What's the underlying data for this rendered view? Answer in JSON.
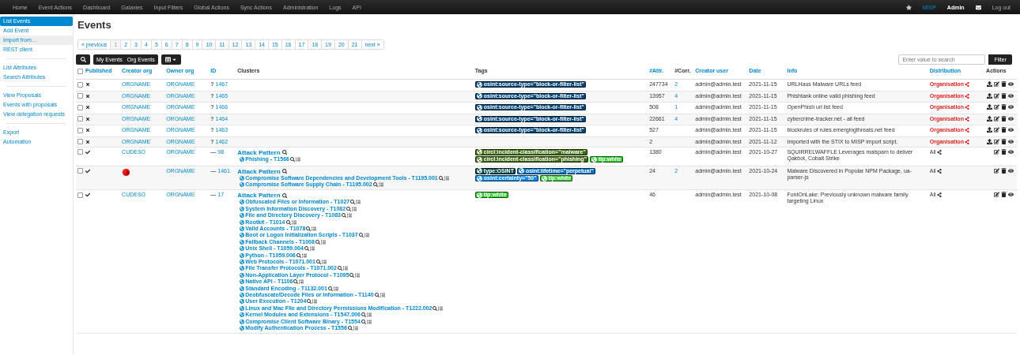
{
  "top_nav": {
    "items": [
      "Home",
      "Event Actions",
      "Dashboard",
      "Galaxies",
      "Input Filters",
      "Global Actions",
      "Sync Actions",
      "Administration",
      "Logs",
      "API"
    ],
    "instance": "MISP",
    "user": "Admin",
    "logout": "Log out"
  },
  "sidebar": {
    "groups": [
      [
        {
          "label": "List Events",
          "selected": true,
          "highlighted": false
        },
        {
          "label": "Add Event",
          "selected": false,
          "highlighted": false
        },
        {
          "label": "Import from…",
          "selected": false,
          "highlighted": true
        },
        {
          "label": "REST client",
          "selected": false,
          "highlighted": false
        }
      ],
      [
        {
          "label": "List Attributes",
          "selected": false,
          "highlighted": false
        },
        {
          "label": "Search Attributes",
          "selected": false,
          "highlighted": false
        }
      ],
      [
        {
          "label": "View Proposals",
          "selected": false,
          "highlighted": false
        },
        {
          "label": "Events with proposals",
          "selected": false,
          "highlighted": false
        },
        {
          "label": "View delegation requests",
          "selected": false,
          "highlighted": false
        }
      ],
      [
        {
          "label": "Export",
          "selected": false,
          "highlighted": false
        },
        {
          "label": "Automation",
          "selected": false,
          "highlighted": false
        }
      ]
    ]
  },
  "title": "Events",
  "pagination": {
    "previous": "« previous",
    "next": "next »",
    "pages": [
      {
        "label": "1",
        "selected": true
      },
      {
        "label": "2",
        "selected": false
      },
      {
        "label": "3",
        "selected": false
      },
      {
        "label": "4",
        "selected": false
      },
      {
        "label": "5",
        "selected": false
      },
      {
        "label": "6",
        "selected": false
      },
      {
        "label": "7",
        "selected": false
      },
      {
        "label": "8",
        "selected": false
      },
      {
        "label": "9",
        "selected": false
      },
      {
        "label": "10",
        "selected": false
      },
      {
        "label": "11",
        "selected": false
      },
      {
        "label": "12",
        "selected": false
      },
      {
        "label": "13",
        "selected": false
      },
      {
        "label": "14",
        "selected": false
      },
      {
        "label": "15",
        "selected": false
      },
      {
        "label": "16",
        "selected": false
      },
      {
        "label": "17",
        "selected": false
      },
      {
        "label": "18",
        "selected": false
      },
      {
        "label": "19",
        "selected": false
      },
      {
        "label": "20",
        "selected": false
      },
      {
        "label": "21",
        "selected": false
      }
    ]
  },
  "toolbar": {
    "filters": [
      "My Events",
      "Org Events"
    ],
    "search": {
      "placeholder": "Enter value to search"
    },
    "filter_button": "Filter"
  },
  "table": {
    "select_all_checked": false,
    "columns": [
      {
        "label": "Published",
        "sortable": true
      },
      {
        "label": "Creator org",
        "sortable": true
      },
      {
        "label": "Owner org",
        "sortable": true
      },
      {
        "label": "ID",
        "sortable": true
      },
      {
        "label": "Clusters",
        "sortable": false
      },
      {
        "label": "Tags",
        "sortable": false
      },
      {
        "label": "#Attr.",
        "sortable": true
      },
      {
        "label": "#Corr.",
        "sortable": false
      },
      {
        "label": "Creator user",
        "sortable": true
      },
      {
        "label": "Date",
        "sortable": true
      },
      {
        "label": "Info",
        "sortable": true
      },
      {
        "label": "Distribution",
        "sortable": true
      },
      {
        "label": "Actions",
        "sortable": false
      }
    ],
    "rows": [
      {
        "checked": false,
        "published": false,
        "creator_org": {
          "kind": "text",
          "label": "ORGNAME"
        },
        "owner_org": "ORGNAME",
        "id_prefix": "?",
        "id": "1467",
        "tags": [
          {
            "label": "osint:source-type=\"block-or-filter-list\"",
            "color": "#004577"
          }
        ],
        "attr": "247734",
        "corr": "2",
        "user": "admin@admin.test",
        "date": "2021-11-15",
        "info": "URLHaus Malware URLs feed",
        "distribution": {
          "label": "Organisation",
          "kind": "organisation"
        },
        "actions": [
          {
            "kind": "publish"
          },
          {
            "kind": "edit"
          },
          {
            "kind": "delete"
          },
          {
            "kind": "view"
          }
        ]
      },
      {
        "checked": false,
        "published": false,
        "creator_org": {
          "kind": "text",
          "label": "ORGNAME"
        },
        "owner_org": "ORGNAME",
        "id_prefix": "?",
        "id": "1465",
        "tags": [
          {
            "label": "osint:source-type=\"block-or-filter-list\"",
            "color": "#004577"
          }
        ],
        "attr": "13957",
        "corr": "4",
        "user": "admin@admin.test",
        "date": "2021-11-15",
        "info": "Phishtank online valid phishing feed",
        "distribution": {
          "label": "Organisation",
          "kind": "organisation"
        },
        "actions": [
          {
            "kind": "publish"
          },
          {
            "kind": "edit"
          },
          {
            "kind": "delete"
          },
          {
            "kind": "view"
          }
        ]
      },
      {
        "checked": false,
        "published": false,
        "creator_org": {
          "kind": "text",
          "label": "ORGNAME"
        },
        "owner_org": "ORGNAME",
        "id_prefix": "?",
        "id": "1466",
        "tags": [
          {
            "label": "osint:source-type=\"block-or-filter-list\"",
            "color": "#004577"
          }
        ],
        "attr": "508",
        "corr": "1",
        "user": "admin@admin.test",
        "date": "2021-11-15",
        "info": "OpenPhish url list feed",
        "distribution": {
          "label": "Organisation",
          "kind": "organisation"
        },
        "actions": [
          {
            "kind": "publish"
          },
          {
            "kind": "edit"
          },
          {
            "kind": "delete"
          },
          {
            "kind": "view"
          }
        ]
      },
      {
        "checked": false,
        "published": false,
        "creator_org": {
          "kind": "text",
          "label": "ORGNAME"
        },
        "owner_org": "ORGNAME",
        "id_prefix": "?",
        "id": "1464",
        "tags": [
          {
            "label": "osint:source-type=\"block-or-filter-list\"",
            "color": "#004577"
          }
        ],
        "attr": "22661",
        "corr": "4",
        "user": "admin@admin.test",
        "date": "2021-11-15",
        "info": "cybercrime-tracker.net - all feed",
        "distribution": {
          "label": "Organisation",
          "kind": "organisation"
        },
        "actions": [
          {
            "kind": "publish"
          },
          {
            "kind": "edit"
          },
          {
            "kind": "delete"
          },
          {
            "kind": "view"
          }
        ]
      },
      {
        "checked": false,
        "published": false,
        "creator_org": {
          "kind": "text",
          "label": "ORGNAME"
        },
        "owner_org": "ORGNAME",
        "id_prefix": "?",
        "id": "1463",
        "tags": [
          {
            "label": "osint:source-type=\"block-or-filter-list\"",
            "color": "#004577"
          }
        ],
        "attr": "527",
        "user": "admin@admin.test",
        "date": "2021-11-15",
        "info": "blockrules of rules.emergingthreats.net feed",
        "distribution": {
          "label": "Organisation",
          "kind": "organisation"
        },
        "actions": [
          {
            "kind": "publish"
          },
          {
            "kind": "edit"
          },
          {
            "kind": "delete"
          },
          {
            "kind": "view"
          }
        ]
      },
      {
        "checked": false,
        "published": false,
        "creator_org": {
          "kind": "text",
          "label": "ORGNAME"
        },
        "owner_org": "ORGNAME",
        "id_prefix": "?",
        "id": "1462",
        "tags": [],
        "attr": "2",
        "user": "admin@admin.test",
        "date": "2021-11-12",
        "info": "Imported with the STIX to MISP import script.",
        "distribution": {
          "label": "Organisation",
          "kind": "organisation"
        },
        "actions": [
          {
            "kind": "publish"
          },
          {
            "kind": "edit"
          },
          {
            "kind": "delete"
          },
          {
            "kind": "view"
          }
        ]
      },
      {
        "checked": false,
        "published": true,
        "creator_org": {
          "kind": "text",
          "label": "CUDESO"
        },
        "owner_org": "ORGNAME",
        "id_prefix": "—",
        "id": "98",
        "clusters": {
          "title": "Attack Pattern",
          "items": [
            "Phishing - T1566"
          ]
        },
        "tags": [
          {
            "label": "circl:incident-classification=\"malware\"",
            "color": "#3d6b0b"
          },
          {
            "label": "circl:incident-classification=\"phishing\"",
            "color": "#3d6b0b"
          },
          {
            "label": "tlp:white",
            "color": "#2ecc2e"
          }
        ],
        "attr": "1380",
        "user": "admin@admin.test",
        "date": "2021-10-27",
        "info": "SQUIRRELWAFFLE Leverages malspam to deliver Qakbot, Cobalt Strike",
        "distribution": {
          "label": "All",
          "kind": "all"
        },
        "actions": [
          {
            "kind": "edit"
          },
          {
            "kind": "delete"
          },
          {
            "kind": "view"
          }
        ]
      },
      {
        "checked": false,
        "published": true,
        "creator_org": {
          "kind": "logo"
        },
        "owner_org": "ORGNAME",
        "id_prefix": "—",
        "id": "1461",
        "clusters": {
          "title": "Attack Pattern",
          "items": [
            "Compromise Software Dependencies and Development Tools - T1195.001",
            "Compromise Software Supply Chain - T1195.002"
          ]
        },
        "tags": [
          {
            "label": "type:OSINT",
            "color": "#004646"
          },
          {
            "label": "osint:lifetime=\"perpetual\"",
            "color": "#0071c3"
          },
          {
            "label": "osint:certainty=\"50\"",
            "color": "#0087e8"
          },
          {
            "label": "tlp:white",
            "color": "#2ecc2e"
          }
        ],
        "attr": "24",
        "corr": "2",
        "user": "admin@admin.test",
        "date": "2021-10-24",
        "info": "Malware Discovered in Popular NPM Package, ua-parser-js",
        "distribution": {
          "label": "All",
          "kind": "all"
        },
        "actions": [
          {
            "kind": "edit"
          },
          {
            "kind": "delete"
          },
          {
            "kind": "view"
          }
        ]
      },
      {
        "checked": false,
        "published": true,
        "creator_org": {
          "kind": "text",
          "label": "CUDESO"
        },
        "owner_org": "ORGNAME",
        "id_prefix": "—",
        "id": "17",
        "clusters": {
          "title": "Attack Pattern",
          "items": [
            "Obfuscated Files or Information - T1027",
            "System Information Discovery - T1082",
            "File and Directory Discovery - T1083",
            "Rootkit - T1014",
            "Valid Accounts - T1078",
            "Boot or Logon Initialization Scripts - T1037",
            "Fallback Channels - T1008",
            "Unix Shell - T1059.004",
            "Python - T1059.006",
            "Web Protocols - T1071.001",
            "File Transfer Protocols - T1071.002",
            "Non-Application Layer Protocol - T1095",
            "Native API - T1106",
            "Standard Encoding - T1132.001",
            "Deobfuscate/Decode Files or Information - T1140",
            "User Execution - T1204",
            "Linux and Mac File and Directory Permissions Modification - T1222.002",
            "Kernel Modules and Extensions - T1547.006",
            "Compromise Client Software Binary - T1554",
            "Modify Authentication Process - T1556"
          ]
        },
        "tags": [
          {
            "label": "tlp:white",
            "color": "#2ecc2e"
          }
        ],
        "attr": "46",
        "user": "admin@admin.test",
        "date": "2021-10-08",
        "info": "FontOnLake: Previously unknown malware family targeting Linux",
        "distribution": {
          "label": "All",
          "kind": "all"
        },
        "actions": [
          {
            "kind": "edit"
          },
          {
            "kind": "delete"
          },
          {
            "kind": "view"
          }
        ]
      }
    ]
  }
}
